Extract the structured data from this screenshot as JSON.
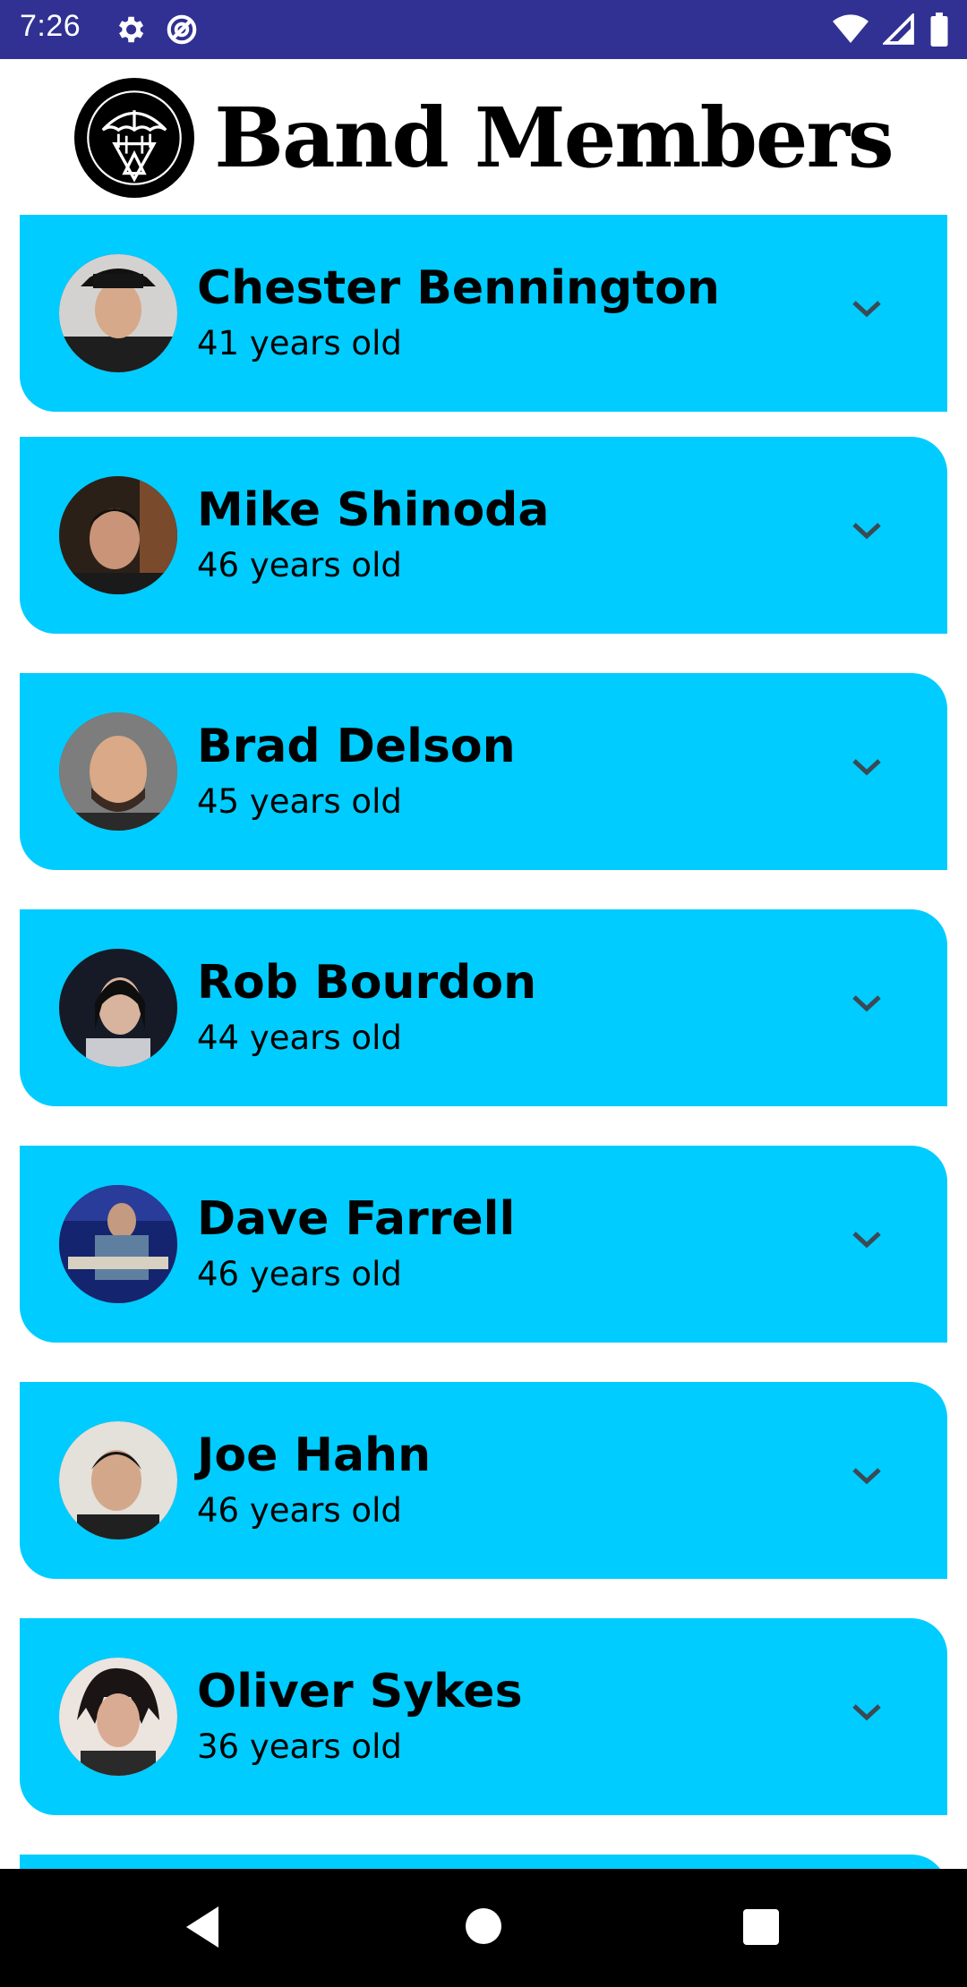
{
  "status_bar": {
    "time": "7:26",
    "left_icons": [
      "gear-icon",
      "no-disturb-icon"
    ],
    "right_icons": [
      "wifi-icon",
      "signal-icon",
      "battery-icon"
    ],
    "background": "#303193"
  },
  "header": {
    "title": "Band Members",
    "logo": "umbrella-logo-icon"
  },
  "members": [
    {
      "name": "Chester Bennington",
      "age": "41 years old",
      "avatar_tone": "#c8c6c4"
    },
    {
      "name": "Mike Shinoda",
      "age": "46 years old",
      "avatar_tone": "#4a3b30"
    },
    {
      "name": "Brad Delson",
      "age": "45 years old",
      "avatar_tone": "#6d6d6d"
    },
    {
      "name": "Rob Bourdon",
      "age": "44 years old",
      "avatar_tone": "#1f2433"
    },
    {
      "name": "Dave Farrell",
      "age": "46 years old",
      "avatar_tone": "#1b2a6b"
    },
    {
      "name": "Joe Hahn",
      "age": "46 years old",
      "avatar_tone": "#d9d5cf"
    },
    {
      "name": "Oliver Sykes",
      "age": "36 years old",
      "avatar_tone": "#e6dcd6"
    }
  ],
  "colors": {
    "card": "#00CCFF",
    "chevron": "#3a4a55"
  },
  "nav_bar": {
    "buttons": [
      "back-icon",
      "home-icon",
      "recents-icon"
    ]
  }
}
